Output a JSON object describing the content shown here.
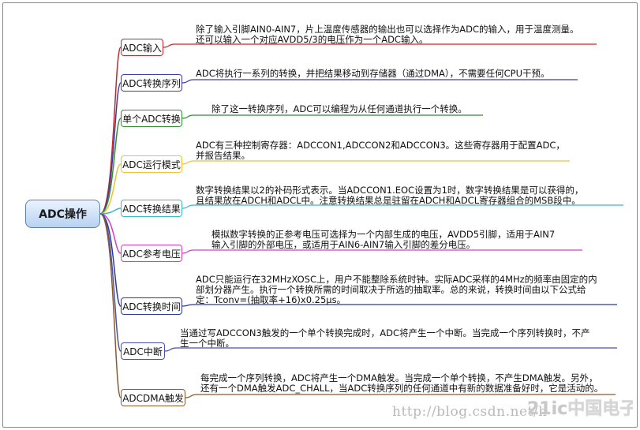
{
  "root": {
    "label": "ADC操作"
  },
  "branches": [
    {
      "label": "ADC输入",
      "color": "#c4262e",
      "lines": [
        "除了输入引脚AIN0-AIN7，片上温度传感器的输出也可以选择作为ADC的输入，用于温度测量。",
        "还可以输入一个对应AVDD5/3的电压作为一个ADC输入。"
      ]
    },
    {
      "label": "ADC转换序列",
      "color": "#3c3ca8",
      "lines": [
        "ADC将执行一系列的转换，并把结果移动到存储器（通过DMA），不需要任何CPU干预。"
      ]
    },
    {
      "label": "单个ADC转换",
      "color": "#2f8f2f",
      "lines": [
        "除了这一转换序列，ADC可以编程为从任何通道执行一个转换。"
      ]
    },
    {
      "label": "ADC运行模式",
      "color": "#f0c030",
      "lines": [
        "ADC有三种控制寄存器：ADCCON1,ADCCON2和ADCCON3。这些寄存器用于配置ADC，",
        "并报告结果。"
      ]
    },
    {
      "label": "ADC转换结果",
      "color": "#38b8cc",
      "lines": [
        "数字转换结果以2的补码形式表示。当ADCCON1.EOC设置为1时，数字转换结果是可以获得的，",
        "且结果放在ADCH和ADCL中。注意转换结果总是驻留在ADCH和ADCL寄存器组合的MSB段中。"
      ]
    },
    {
      "label": "ADC参考电压",
      "color": "#d040c8",
      "lines": [
        "模拟数字转换的正参考电压可选择为一个内部生成的电压，AVDD5引脚，适用于AIN7",
        "输入引脚的外部电压，或适用于AIN6-AIN7输入引脚的差分电压。"
      ]
    },
    {
      "label": "ADC转换时间",
      "color": "#2b3a9a",
      "lines": [
        "ADC只能运行在32MHzXOSC上，用户不能整除系统时钟。实际ADC采样的4MHz的频率由固定的内",
        "部划分器产生。执行一个转换所需的时间取决于所选的抽取率。总的来说，转换时间由以下公式给",
        "定：Tconv=(抽取率+16)x0.25μs。"
      ]
    },
    {
      "label": "ADC中断",
      "color": "#4b50a8",
      "lines": [
        "当通过写ADCCON3触发的一个单个转换完成时，ADC将产生一个中断。当完成一个序列转换时，不产",
        "生一个中断。"
      ]
    },
    {
      "label": "ADCDMA触发",
      "color": "#8a5a2a",
      "lines": [
        "每完成一个序列转换，ADC将产生一个DMA触发。当完成一个单个转换，不产生DMA触发。另外，",
        "还有一个DMA触发ADC_CHALL，当ADC转换序列的任何通道中有新的数据准备好时，它是活动的。"
      ]
    }
  ],
  "watermark": {
    "text": "http://blog.csdn.net/h"
  },
  "logo": {
    "text": "21ic中国电子网"
  }
}
